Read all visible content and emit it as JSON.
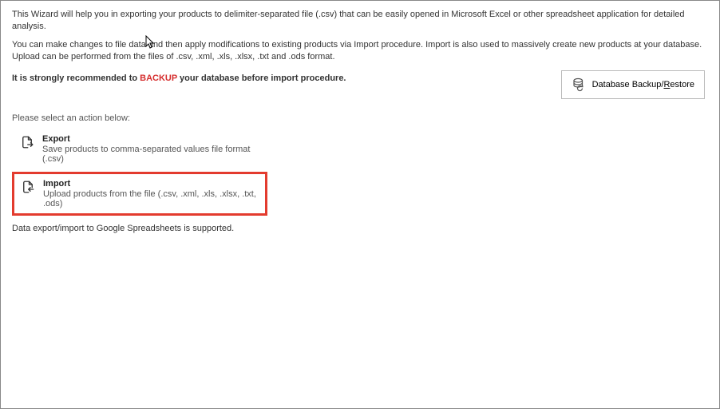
{
  "intro": {
    "p1": "This Wizard will help you in exporting your products to delimiter-separated file (.csv) that can be easily opened in Microsoft Excel or other spreadsheet application for detailed analysis.",
    "p2": "You can make changes to file data and then apply modifications to existing products via Import procedure. Import is also used to massively create new products at your database. Upload can be performed from the files of .csv, .xml, .xls, .xlsx, .txt and .ods format."
  },
  "backup": {
    "pre": "It is strongly recommended to ",
    "word": "BACKUP",
    "post": " your database before import procedure."
  },
  "backup_button": {
    "pre": "Database Backup/",
    "hotkey": "R",
    "post": "estore"
  },
  "select_label": "Please select an action below:",
  "options": {
    "export": {
      "title": "Export",
      "sub": "Save products to comma-separated values file format (.csv)"
    },
    "import": {
      "title": "Import",
      "sub": "Upload products from the file (.csv, .xml, .xls, .xlsx, .txt, .ods)"
    }
  },
  "footer": "Data export/import to Google Spreadsheets is supported."
}
